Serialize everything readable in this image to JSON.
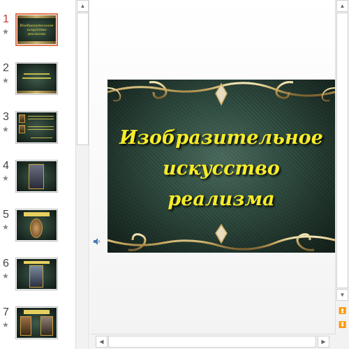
{
  "slide": {
    "title_line1": "Изобразительное",
    "title_line2": "искусство реализма"
  },
  "thumbnails": [
    {
      "number": "1",
      "active": true
    },
    {
      "number": "2",
      "active": false
    },
    {
      "number": "3",
      "active": false
    },
    {
      "number": "4",
      "active": false
    },
    {
      "number": "5",
      "active": false
    },
    {
      "number": "6",
      "active": false
    },
    {
      "number": "7",
      "active": false
    }
  ],
  "icons": {
    "star": "★",
    "up": "▲",
    "down": "▼",
    "left": "◀",
    "right": "▶",
    "prev_slide": "⏫",
    "next_slide": "⏬"
  },
  "colors": {
    "active_number": "#c0392b",
    "active_border": "#e0724c",
    "title": "#f6ec28",
    "slide_bg": "#2d4a3e",
    "gold": "#c8b06a"
  }
}
